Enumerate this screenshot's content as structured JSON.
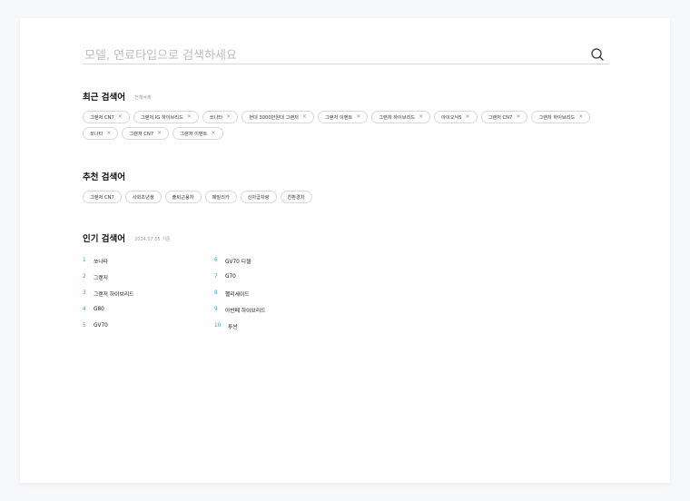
{
  "search": {
    "placeholder": "모델, 연료타입으로 검색하세요"
  },
  "recent": {
    "title": "최근 검색어",
    "clear_all": "전체삭제",
    "items": [
      "그랜저 CN7",
      "그랜저 IG 하이브리드",
      "쏘나타",
      "현대 3000만원대 그랜저",
      "그랜저 이벤트",
      "그랜저 하이브리드",
      "아이오닉5",
      "그랜저 CN7",
      "그랜저 하이브리드",
      "쏘나타",
      "그랜저 CN7",
      "그랜저 이벤트"
    ],
    "remove_glyph": "×"
  },
  "recommended": {
    "title": "추천 검색어",
    "items": [
      "그랜저 CN7",
      "사회초년생",
      "출퇴근용차",
      "패밀리카",
      "신차급차량",
      "친환경차"
    ]
  },
  "popular": {
    "title": "인기 검색어",
    "date": "2024.07.05 기준",
    "left": [
      {
        "rank": "1",
        "label": "쏘나타"
      },
      {
        "rank": "2",
        "label": "그랜저"
      },
      {
        "rank": "3",
        "label": "그랜저 하이브리드"
      },
      {
        "rank": "4",
        "label": "G80"
      },
      {
        "rank": "5",
        "label": "GV70"
      }
    ],
    "right": [
      {
        "rank": "6",
        "label": "GV70 디젤"
      },
      {
        "rank": "7",
        "label": "G70"
      },
      {
        "rank": "8",
        "label": "펠리세이드"
      },
      {
        "rank": "9",
        "label": "아반떼 하이브리드"
      },
      {
        "rank": "10",
        "label": "투싼"
      }
    ]
  },
  "colors": {
    "accent": "#1ea7c9"
  }
}
